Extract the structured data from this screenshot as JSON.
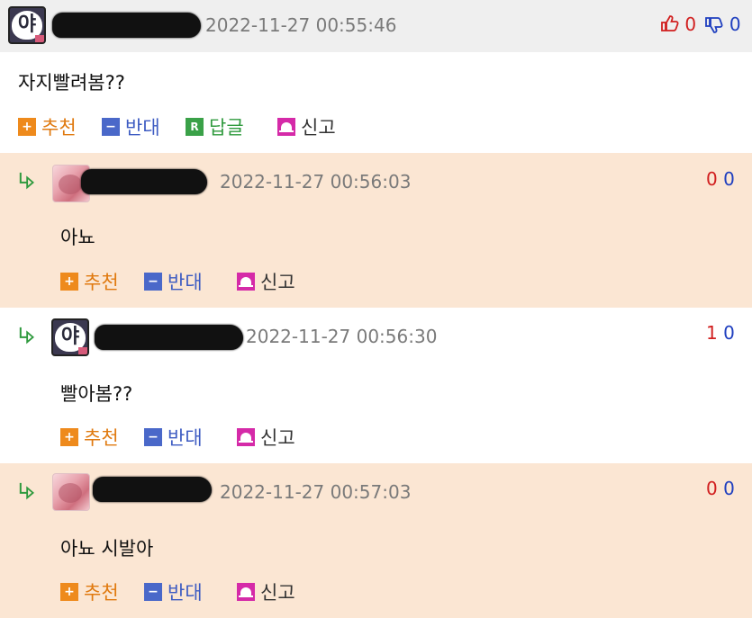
{
  "post": {
    "avatar_glyph": "야",
    "timestamp": "2022-11-27 00:55:46",
    "likes": "0",
    "dislikes": "0",
    "content": "자지빨려봄??",
    "actions": {
      "recommend": "추천",
      "oppose": "반대",
      "reply": "답글",
      "reply_badge": "R",
      "report": "신고"
    }
  },
  "replies": [
    {
      "timestamp": "2022-11-27 00:56:03",
      "likes": "0",
      "dislikes": "0",
      "content": "아뇨",
      "actions": {
        "recommend": "추천",
        "oppose": "반대",
        "report": "신고"
      }
    },
    {
      "avatar_glyph": "야",
      "timestamp": "2022-11-27 00:56:30",
      "likes": "1",
      "dislikes": "0",
      "content": "빨아봄??",
      "actions": {
        "recommend": "추천",
        "oppose": "반대",
        "report": "신고"
      }
    },
    {
      "timestamp": "2022-11-27 00:57:03",
      "likes": "0",
      "dislikes": "0",
      "content": "아뇨 시발아",
      "actions": {
        "recommend": "추천",
        "oppose": "반대",
        "report": "신고"
      }
    }
  ],
  "colors": {
    "reply_bg_peach": "#fbe6d3",
    "header_bg": "#efefef",
    "like_red": "#d11f1f",
    "dislike_blue": "#1f3fbf",
    "recommend_orange": "#ee8a1c",
    "oppose_blue": "#4a68c9",
    "reply_green": "#3aa148",
    "report_magenta": "#d52aa8"
  },
  "icons": {
    "like": "thumbs-up-icon",
    "dislike": "thumbs-down-icon",
    "reply_arrow": "reply-arrow-icon",
    "recommend": "plus-icon",
    "oppose": "minus-icon",
    "report": "siren-icon"
  }
}
